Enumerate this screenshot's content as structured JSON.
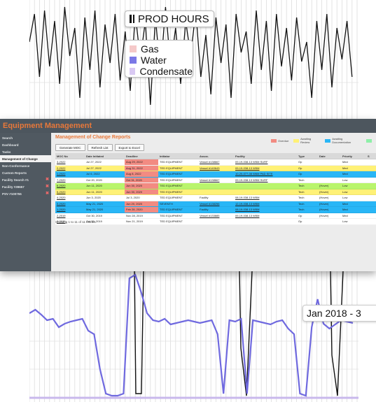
{
  "chart": {
    "title": "PROD HOURS",
    "legend": [
      {
        "label": "Gas",
        "color": "#f5c9c9"
      },
      {
        "label": "Water",
        "color": "#7b78e6"
      },
      {
        "label": "Condensate",
        "color": "#d9c9f3"
      }
    ],
    "tooltip": "Jan 2018 - 3"
  },
  "app": {
    "title": "Equipment Management",
    "sidebar": [
      {
        "label": "Search"
      },
      {
        "label": "Dashboard"
      },
      {
        "label": "Tasks"
      },
      {
        "label": "Management of Change",
        "active": true
      },
      {
        "label": "Non-Conformance"
      },
      {
        "label": "Custom Reports"
      },
      {
        "label": "Facility Search #1",
        "closable": true
      },
      {
        "label": "Facility #39657",
        "closable": true
      },
      {
        "label": "PSV #100755",
        "closable": true
      }
    ],
    "page_title": "Management of Change Reports",
    "status_legend": [
      {
        "label": "Overdue",
        "color": "#f28b82"
      },
      {
        "label": "Awaiting Review",
        "color": "#fff176"
      },
      {
        "label": "Awaiting Documentation",
        "color": "#29b6f6"
      },
      {
        "label": "",
        "color": "#8ef0a8"
      }
    ],
    "buttons": {
      "generate": "Generate MOC",
      "refresh": "Refresh List",
      "export": "Export to Excel"
    },
    "columns": [
      "MOC No",
      "Date Initiated",
      "Deadline",
      "Initiator",
      "Assoc.",
      "Facility",
      "Type",
      "Date",
      "Priority",
      "S"
    ],
    "rows": [
      {
        "no": "3-2022",
        "initiated": "Jul 27, 2022",
        "deadline": "Aug 29, 2022",
        "initiator": "TED EQUIPMENT",
        "assoc": "Vessel #138667",
        "facility": "09-19-038-13 W5M SURF",
        "type": "Op",
        "date": "",
        "priority": "Med",
        "row_color": "#ffffff",
        "deadline_color": "#f28b82"
      },
      {
        "no": "2-2022",
        "initiated": "Jul 27, 2022",
        "deadline": "Aug 31, 2022",
        "initiator": "TED EQUIPMENT",
        "assoc": "Vessel #140643",
        "facility": "09-19-038-13 W5M",
        "type": "Op",
        "date": "",
        "priority": "Med",
        "row_color": "#fff176",
        "deadline_color": "#f28b82"
      },
      {
        "no": "1-2022",
        "initiated": "Jul 6, 2022",
        "deadline": "Aug 8, 2022",
        "initiator": "TED EQUIPMENT",
        "assoc": "",
        "facility": "10-20-077-08 W6M PAD SITE",
        "type": "Op",
        "date": "",
        "priority": "Med",
        "row_color": "#29b6f6",
        "deadline_color": "#f28b82"
      },
      {
        "no": "7-2020",
        "initiated": "Oct 20, 2020",
        "deadline": "Oct 31, 2020",
        "initiator": "TED EQUIPMENT",
        "assoc": "Vessel #138667",
        "facility": "09-19-038-13 W5M SURF",
        "type": "Tech",
        "date": "",
        "priority": "Low",
        "row_color": "#ffffff",
        "deadline_color": "#f28b82"
      },
      {
        "no": "6-2020",
        "initiated": "Jun 11, 2020",
        "deadline": "Jun 30, 2020",
        "initiator": "TED EQUIPMENT",
        "assoc": "",
        "facility": "",
        "type": "Tech",
        "date": "(Hover)",
        "priority": "Low",
        "row_color": "#b9f56c",
        "deadline_color": "#f28b82"
      },
      {
        "no": "5-2020",
        "initiated": "Jun 11, 2020",
        "deadline": "Jun 30, 2020",
        "initiator": "TED EQUIPMENT",
        "assoc": "",
        "facility": "",
        "type": "Tech",
        "date": "(Hover)",
        "priority": "Low",
        "row_color": "#fff176",
        "deadline_color": "#f28b82"
      },
      {
        "no": "4-2020",
        "initiated": "Jun 3, 2020",
        "deadline": "Jul 3, 2020",
        "initiator": "TED EQUIPMENT",
        "assoc": "Facility",
        "facility": "08-19-038-13 W5M",
        "type": "Tech",
        "date": "(Hover)",
        "priority": "Low",
        "row_color": "#ffffff",
        "deadline_color": ""
      },
      {
        "no": "3-2020",
        "initiated": "May 21, 2020",
        "deadline": "Jun 20, 2020",
        "initiator": "SEVENTH",
        "assoc": "Vessel #138256",
        "facility": "12-19-038-13 W5M",
        "type": "Tech",
        "date": "(Hover)",
        "priority": "Med",
        "row_color": "#29b6f6",
        "deadline_color": "#f28b82"
      },
      {
        "no": "1-2020",
        "initiated": "May 21, 2020",
        "deadline": "Feb 28, 2020",
        "initiator": "TED EQUIPMENT",
        "assoc": "Facility",
        "facility": "08-19-038-13 W5M",
        "type": "Tech",
        "date": "(Hover)",
        "priority": "Med",
        "row_color": "#29b6f6",
        "deadline_color": "#f28b82"
      },
      {
        "no": "2-2019",
        "initiated": "Oct 30, 2019",
        "deadline": "Nov 28, 2019",
        "initiator": "TED EQUIPMENT",
        "assoc": "Vessel #133885",
        "facility": "09-19-038-13 W5M",
        "type": "Op",
        "date": "(Hover)",
        "priority": "Med",
        "row_color": "#ffffff",
        "deadline_color": ""
      },
      {
        "no": "1-2019",
        "initiated": "Oct 30, 2019",
        "deadline": "Nov 21, 2019",
        "initiator": "TED EQUIPMENT",
        "assoc": "",
        "facility": "",
        "type": "Op",
        "date": "",
        "priority": "Low",
        "row_color": "#ffffff",
        "deadline_color": ""
      }
    ],
    "footer": "Showing 1 to 11 of 11 entries"
  }
}
